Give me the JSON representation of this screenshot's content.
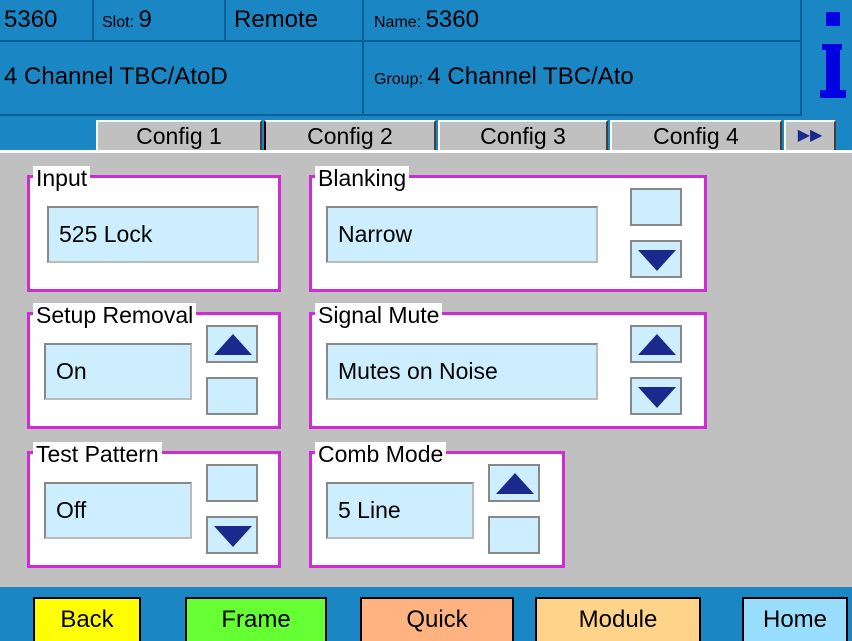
{
  "header": {
    "model": "5360",
    "slot_label": "Slot:",
    "slot_value": "9",
    "mode": "Remote",
    "name_label": "Name:",
    "name_value": "5360",
    "description": "4 Channel TBC/AtoD",
    "group_label": "Group:",
    "group_value": "4 Channel TBC/Ato",
    "info_icon": "info-icon"
  },
  "tabs": [
    "Config 1",
    "Config 2",
    "Config 3",
    "Config 4"
  ],
  "tabs_more_glyph": "▶▶",
  "panels": {
    "input": {
      "title": "Input",
      "value": "525 Lock"
    },
    "blanking": {
      "title": "Blanking",
      "value": "Narrow"
    },
    "setup_removal": {
      "title": "Setup Removal",
      "value": "On"
    },
    "signal_mute": {
      "title": "Signal Mute",
      "value": "Mutes on Noise"
    },
    "test_pattern": {
      "title": "Test Pattern",
      "value": "Off"
    },
    "comb_mode": {
      "title": "Comb Mode",
      "value": "5 Line"
    }
  },
  "bottom": {
    "back": "Back",
    "frame": "Frame",
    "quick": "Quick",
    "module": "Module",
    "home": "Home"
  },
  "colors": {
    "header_bg": "#1a86c4",
    "panel_border": "#d02cd6",
    "value_bg": "#cceeff",
    "arrow": "#1a2a8c",
    "back_btn": "#ffff00",
    "frame_btn": "#66ff33",
    "quick_btn": "#ffb380",
    "module_btn": "#ffd48a",
    "home_btn": "#99ddff"
  }
}
